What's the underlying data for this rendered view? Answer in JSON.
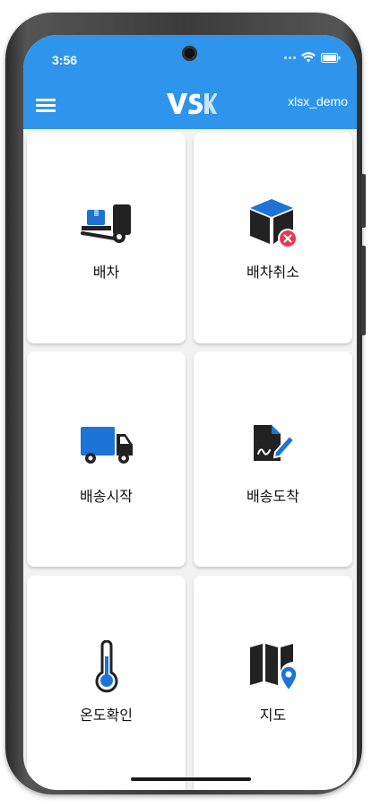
{
  "status": {
    "time": "3:56"
  },
  "appbar": {
    "logo": "VSK",
    "user": "xlsx_demo",
    "menu_icon": "hamburger-menu-icon"
  },
  "menu": [
    {
      "label": "배차",
      "icon": "forklift-dispatch-icon"
    },
    {
      "label": "배차취소",
      "icon": "box-cancel-icon"
    },
    {
      "label": "배송시작",
      "icon": "truck-icon"
    },
    {
      "label": "배송도착",
      "icon": "document-sign-icon"
    },
    {
      "label": "온도확인",
      "icon": "thermometer-icon"
    },
    {
      "label": "지도",
      "icon": "map-pin-icon"
    }
  ],
  "colors": {
    "primary": "#2f95ec",
    "icon_dark": "#222222",
    "icon_blue": "#1e73d6",
    "cancel_red": "#e53950"
  }
}
